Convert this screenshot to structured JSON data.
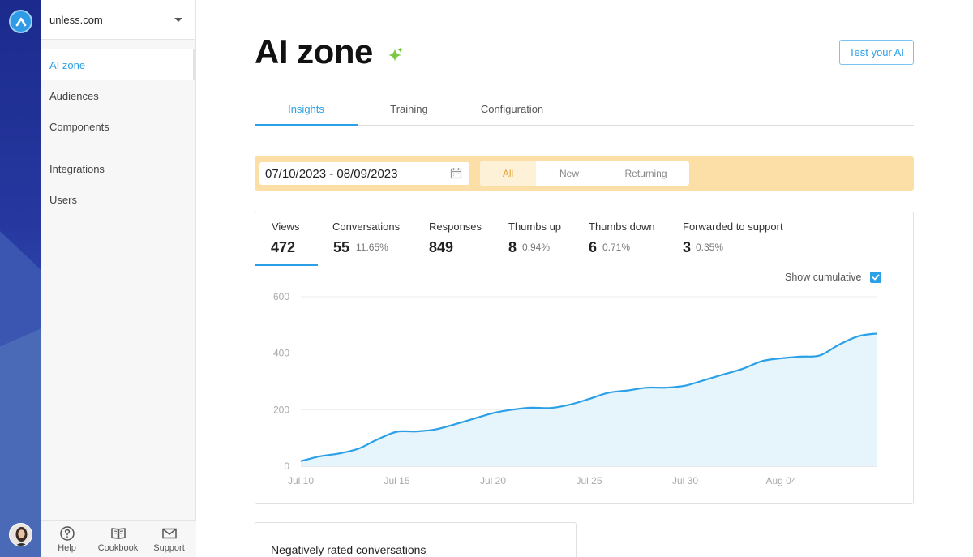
{
  "rail": {
    "logo_icon": "unless-logo-icon",
    "avatar_icon": "user-avatar"
  },
  "sidebar": {
    "site": "unless.com",
    "items": [
      {
        "label": "AI zone",
        "active": true
      },
      {
        "label": "Audiences"
      },
      {
        "label": "Components"
      }
    ],
    "items2": [
      {
        "label": "Integrations"
      },
      {
        "label": "Users"
      }
    ],
    "footer": [
      {
        "label": "Help",
        "icon": "help-circle-icon"
      },
      {
        "label": "Cookbook",
        "icon": "book-icon"
      },
      {
        "label": "Support",
        "icon": "mail-icon"
      }
    ]
  },
  "header": {
    "title": "AI zone",
    "sparkle_icon": "sparkle-icon",
    "test_button": "Test your AI"
  },
  "tabs": [
    {
      "label": "Insights",
      "active": true
    },
    {
      "label": "Training"
    },
    {
      "label": "Configuration"
    }
  ],
  "filters": {
    "date_range": "07/10/2023 - 08/09/2023",
    "segments": [
      "All",
      "New",
      "Returning"
    ],
    "selected_segment": "All"
  },
  "metrics": [
    {
      "label": "Views",
      "value": "472",
      "pct": ""
    },
    {
      "label": "Conversations",
      "value": "55",
      "pct": "11.65%"
    },
    {
      "label": "Responses",
      "value": "849",
      "pct": ""
    },
    {
      "label": "Thumbs up",
      "value": "8",
      "pct": "0.94%"
    },
    {
      "label": "Thumbs down",
      "value": "6",
      "pct": "0.71%"
    },
    {
      "label": "Forwarded to support",
      "value": "3",
      "pct": "0.35%"
    }
  ],
  "chart_options": {
    "cumulative_label": "Show cumulative",
    "cumulative_checked": true
  },
  "chart_data": {
    "type": "area",
    "x": [
      "2023-07-10",
      "2023-07-11",
      "2023-07-12",
      "2023-07-13",
      "2023-07-14",
      "2023-07-15",
      "2023-07-16",
      "2023-07-17",
      "2023-07-18",
      "2023-07-19",
      "2023-07-20",
      "2023-07-21",
      "2023-07-22",
      "2023-07-23",
      "2023-07-24",
      "2023-07-25",
      "2023-07-26",
      "2023-07-27",
      "2023-07-28",
      "2023-07-29",
      "2023-07-30",
      "2023-07-31",
      "2023-08-01",
      "2023-08-02",
      "2023-08-03",
      "2023-08-04",
      "2023-08-05",
      "2023-08-06",
      "2023-08-07",
      "2023-08-08",
      "2023-08-09"
    ],
    "series": [
      {
        "values": [
          18,
          35,
          45,
          62,
          95,
          122,
          123,
          130,
          148,
          168,
          188,
          200,
          207,
          206,
          218,
          238,
          260,
          268,
          278,
          278,
          285,
          305,
          325,
          345,
          372,
          382,
          388,
          392,
          430,
          460,
          470
        ]
      }
    ],
    "x_ticks": [
      "Jul 10",
      "Jul 15",
      "Jul 20",
      "Jul 25",
      "Jul 30",
      "Aug 04"
    ],
    "y_ticks": [
      0,
      200,
      400,
      600
    ],
    "ylim": [
      0,
      600
    ],
    "grid": true,
    "line_color": "#2ba0e6",
    "fill_color": "#e6f4fc"
  },
  "negative_card": {
    "title": "Negatively rated conversations"
  }
}
